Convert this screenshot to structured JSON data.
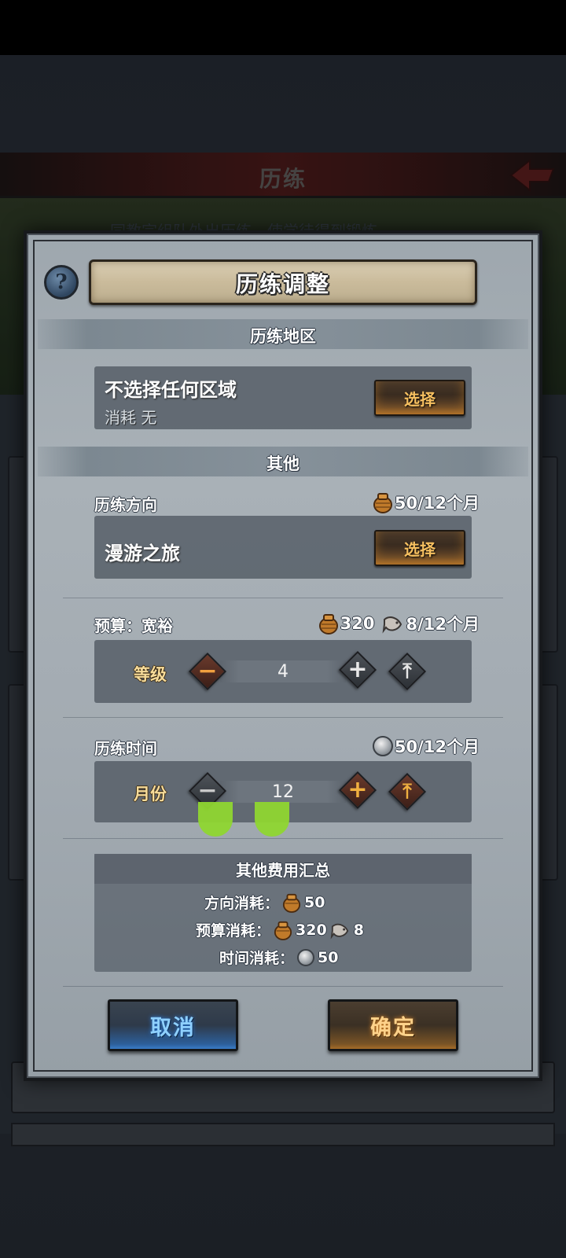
{
  "background": {
    "header_title": "历练",
    "info_text": "同教宗组队外出历练，使学徒得到锻炼"
  },
  "modal": {
    "title": "历练调整",
    "help_glyph": "?",
    "region_section": {
      "heading": "历练地区",
      "region_name": "不选择任何区域",
      "cost_text": "消耗   无",
      "select_label": "选择"
    },
    "other_section": {
      "heading": "其他",
      "direction": {
        "label": "历练方向",
        "cost": "50/12个月",
        "value": "漫游之旅",
        "select_label": "选择"
      },
      "budget": {
        "label": "预算：宽裕",
        "cost_bag": "320",
        "cost_fish": "8/12个月",
        "stepper_label": "等级",
        "value": "4"
      },
      "time": {
        "label": "历练时间",
        "cost": "50/12个月",
        "stepper_label": "月份",
        "value": "12"
      }
    },
    "summary": {
      "title": "其他费用汇总",
      "rows": [
        {
          "label": "方向消耗：",
          "bag": "50"
        },
        {
          "label": "预算消耗：",
          "bag": "320",
          "fish": "8"
        },
        {
          "label": "时间消耗：",
          "coin": "50"
        }
      ]
    },
    "cancel_label": "取消",
    "confirm_label": "确定"
  },
  "glyphs": {
    "minus": "−",
    "plus": "+",
    "max": "⤒"
  },
  "colors": {
    "gold_text": "#f7c060",
    "cancel_blue": "#8fd0ff",
    "confirm_orange": "#ffd28a",
    "touch_green": "#8fd630"
  }
}
